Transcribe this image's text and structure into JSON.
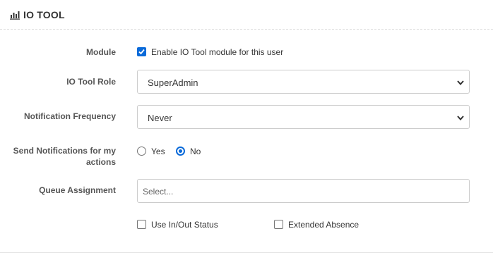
{
  "header": {
    "title": "IO TOOL",
    "icon": "bar-chart-icon"
  },
  "module": {
    "label": "Module",
    "checkbox_label": "Enable IO Tool module for this user",
    "checked": true
  },
  "role": {
    "label": "IO Tool Role",
    "value": "SuperAdmin"
  },
  "frequency": {
    "label": "Notification Frequency",
    "value": "Never"
  },
  "send_notifications": {
    "label": "Send Notifications for my actions",
    "yes_label": "Yes",
    "no_label": "No",
    "selected": "No"
  },
  "queue": {
    "label": "Queue Assignment",
    "placeholder": "Select..."
  },
  "options": {
    "in_out_label": "Use In/Out Status",
    "in_out_checked": false,
    "extended_label": "Extended Absence",
    "extended_checked": false
  },
  "colors": {
    "accent": "#0a6ad9",
    "border": "#cccccc"
  }
}
